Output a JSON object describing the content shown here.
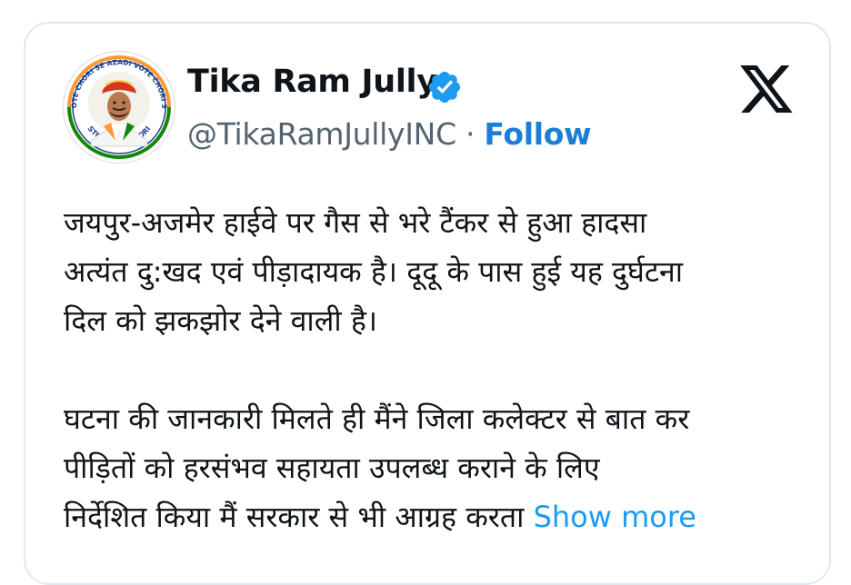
{
  "author": {
    "display_name": "Tika Ram Jully",
    "handle": "@TikaRamJullyINC",
    "separator": "·",
    "follow_label": "Follow",
    "verified_icon": "verified-badge-icon",
    "avatar_icon": "profile-avatar",
    "avatar_text": {
      "top_arc": "VOTE CHORI SE AZADI VOTE CHORI SE",
      "bottom_arc": "STOP VOTE CHORI"
    }
  },
  "platform": {
    "logo": "x-logo-icon"
  },
  "tweet": {
    "paragraph_1": "जयपुर-अजमेर हाईवे पर गैस से भरे टैंकर से हुआ हादसा\nअत्यंत दु:खद एवं पीड़ादायक है। दूदू के पास हुई यह दुर्घटना\nदिल को झकझोर देने वाली है।",
    "paragraph_2": "घटना की जानकारी मिलते ही मैंने जिला कलेक्टर से बात कर\nपीड़ितों को हरसंभव सहायता उपलब्ध कराने के लिए\nनिर्देशित किया मैं सरकार से भी आग्रह करता",
    "show_more_label": "Show more"
  },
  "colors": {
    "link": "#1d9bf0",
    "follow": "#1d7ed6",
    "text_primary": "#0f1419",
    "text_secondary": "#536471",
    "card_border": "#e1e8ed",
    "saffron": "#ff9933",
    "green": "#138808"
  }
}
